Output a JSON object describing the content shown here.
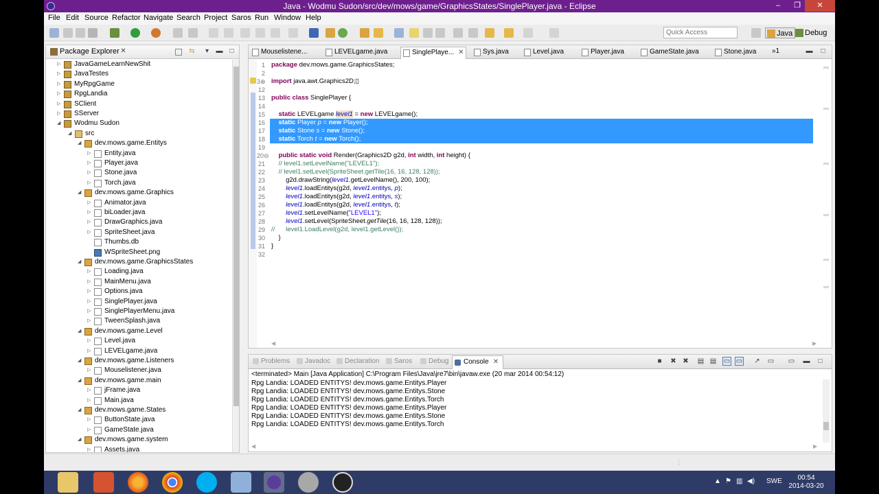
{
  "window": {
    "title": "Java - Wodmu Sudon/src/dev/mows/game/GraphicsStates/SinglePlayer.java - Eclipse",
    "minimize": "–",
    "maximize": "❐",
    "close": "✕"
  },
  "menu": [
    "File",
    "Edit",
    "Source",
    "Refactor",
    "Navigate",
    "Search",
    "Project",
    "Saros",
    "Run",
    "Window",
    "Help"
  ],
  "toolbar": {
    "quick_access_placeholder": "Quick Access",
    "perspectives": [
      "Java",
      "Debug"
    ]
  },
  "package_explorer": {
    "title": "Package Explorer",
    "tree": [
      {
        "label": "JavaGameLearnNewShit",
        "depth": 0,
        "kind": "proj",
        "expanded": false
      },
      {
        "label": "JavaTestes",
        "depth": 0,
        "kind": "proj",
        "expanded": false
      },
      {
        "label": "MyRpgGame",
        "depth": 0,
        "kind": "proj",
        "expanded": false
      },
      {
        "label": "RpgLandia",
        "depth": 0,
        "kind": "proj",
        "expanded": false
      },
      {
        "label": "SClient",
        "depth": 0,
        "kind": "proj",
        "expanded": false
      },
      {
        "label": "SServer",
        "depth": 0,
        "kind": "proj",
        "expanded": false
      },
      {
        "label": "Wodmu Sudon",
        "depth": 0,
        "kind": "proj",
        "expanded": true
      },
      {
        "label": "src",
        "depth": 1,
        "kind": "src",
        "expanded": true
      },
      {
        "label": "dev.mows.game.Entitys",
        "depth": 2,
        "kind": "pkgi",
        "expanded": true
      },
      {
        "label": "Entity.java",
        "depth": 3,
        "kind": "file",
        "expanded": false
      },
      {
        "label": "Player.java",
        "depth": 3,
        "kind": "file",
        "expanded": false
      },
      {
        "label": "Stone.java",
        "depth": 3,
        "kind": "file",
        "expanded": false
      },
      {
        "label": "Torch.java",
        "depth": 3,
        "kind": "file",
        "expanded": false
      },
      {
        "label": "dev.mows.game.Graphics",
        "depth": 2,
        "kind": "pkgi",
        "expanded": true
      },
      {
        "label": "Animator.java",
        "depth": 3,
        "kind": "file",
        "expanded": false
      },
      {
        "label": "biLoader.java",
        "depth": 3,
        "kind": "file",
        "expanded": false
      },
      {
        "label": "DrawGraphics.java",
        "depth": 3,
        "kind": "file",
        "expanded": false
      },
      {
        "label": "SpriteSheet.java",
        "depth": 3,
        "kind": "file",
        "expanded": false
      },
      {
        "label": "Thumbs.db",
        "depth": 3,
        "kind": "file",
        "expanded": null
      },
      {
        "label": "WSpriteSheet.png",
        "depth": 3,
        "kind": "img",
        "expanded": null
      },
      {
        "label": "dev.mows.game.GraphicsStates",
        "depth": 2,
        "kind": "pkgi",
        "expanded": true
      },
      {
        "label": "Loading.java",
        "depth": 3,
        "kind": "file",
        "expanded": false
      },
      {
        "label": "MainMenu.java",
        "depth": 3,
        "kind": "file",
        "expanded": false
      },
      {
        "label": "Options.java",
        "depth": 3,
        "kind": "file",
        "expanded": false
      },
      {
        "label": "SinglePlayer.java",
        "depth": 3,
        "kind": "file",
        "expanded": false
      },
      {
        "label": "SinglePlayerMenu.java",
        "depth": 3,
        "kind": "file",
        "expanded": false
      },
      {
        "label": "TweenSplash.java",
        "depth": 3,
        "kind": "file",
        "expanded": false
      },
      {
        "label": "dev.mows.game.Level",
        "depth": 2,
        "kind": "pkgi",
        "expanded": true
      },
      {
        "label": "Level.java",
        "depth": 3,
        "kind": "file",
        "expanded": false
      },
      {
        "label": "LEVELgame.java",
        "depth": 3,
        "kind": "file",
        "expanded": false
      },
      {
        "label": "dev.mows.game.Listeners",
        "depth": 2,
        "kind": "pkgi",
        "expanded": true
      },
      {
        "label": "Mouselistener.java",
        "depth": 3,
        "kind": "file",
        "expanded": false
      },
      {
        "label": "dev.mows.game.main",
        "depth": 2,
        "kind": "pkgi",
        "expanded": true
      },
      {
        "label": "jFrame.java",
        "depth": 3,
        "kind": "file",
        "expanded": false
      },
      {
        "label": "Main.java",
        "depth": 3,
        "kind": "file",
        "expanded": false
      },
      {
        "label": "dev.mows.game.States",
        "depth": 2,
        "kind": "pkgi",
        "expanded": true
      },
      {
        "label": "ButtonState.java",
        "depth": 3,
        "kind": "file",
        "expanded": false
      },
      {
        "label": "GameState.java",
        "depth": 3,
        "kind": "file",
        "expanded": false
      },
      {
        "label": "dev.mows.game.system",
        "depth": 2,
        "kind": "pkgi",
        "expanded": true
      },
      {
        "label": "Assets.java",
        "depth": 3,
        "kind": "file",
        "expanded": false
      }
    ]
  },
  "editor": {
    "tabs": [
      {
        "label": "Mouselistene...",
        "active": false
      },
      {
        "label": "LEVELgame.java",
        "active": false
      },
      {
        "label": "SinglePlaye...",
        "active": true
      },
      {
        "label": "Sys.java",
        "active": false
      },
      {
        "label": "Level.java",
        "active": false
      },
      {
        "label": "Player.java",
        "active": false
      },
      {
        "label": "GameState.java",
        "active": false
      },
      {
        "label": "Stone.java",
        "active": false
      }
    ],
    "overflow": "»1",
    "lines": [
      {
        "n": "1",
        "selected": false,
        "html": "<span class=\"kw\">package</span> dev.mows.game.GraphicsStates;"
      },
      {
        "n": "2",
        "selected": false,
        "html": ""
      },
      {
        "n": "3⊕",
        "selected": false,
        "html": "<span class=\"kw\">import</span> java.awt.Graphics2D;▯"
      },
      {
        "n": "12",
        "selected": false,
        "html": ""
      },
      {
        "n": "13",
        "selected": false,
        "html": "<span class=\"kw\">public class</span> SinglePlayer {"
      },
      {
        "n": "14",
        "selected": false,
        "html": ""
      },
      {
        "n": "15",
        "selected": false,
        "html": "    <span class=\"kw\">static</span> LEVELgame <span class=\"fld\" style=\"background:#f0e0c8\">level1</span> = <span class=\"kw\">new</span> LEVELgame();"
      },
      {
        "n": "16",
        "selected": true,
        "html": "    <span>static</span> Player <span>p</span> = <span>new</span> Player();"
      },
      {
        "n": "17",
        "selected": true,
        "html": "    <span>static</span> Stone <span>s</span> = <span>new</span> Stone();"
      },
      {
        "n": "18",
        "selected": true,
        "html": "    <span>static</span> Torch <span>t</span> = <span>new</span> Torch();"
      },
      {
        "n": "19",
        "selected": false,
        "html": ""
      },
      {
        "n": "20⊖",
        "selected": false,
        "html": "    <span class=\"kw\">public static void</span> Render(Graphics2D g2d, <span class=\"kw\">int</span> width, <span class=\"kw\">int</span> height) {"
      },
      {
        "n": "21",
        "selected": false,
        "html": "    <span class=\"cm\">// level1.setLevelName(\"LEVEL1\");</span>"
      },
      {
        "n": "22",
        "selected": false,
        "html": "    <span class=\"cm\">// level1.setLevel(SpriteSheet.getTile(16, 16, 128, 128));</span>"
      },
      {
        "n": "23",
        "selected": false,
        "html": "        g2d.drawString(<span class=\"fld\">level1</span>.getLevelName(), 200, 100);"
      },
      {
        "n": "24",
        "selected": false,
        "html": "        <span class=\"fld\">level1</span>.loadEntitys(g2d, <span class=\"fld\">level1</span>.<span class=\"fld\" style=\"font-style:normal\">entitys</span>, <span class=\"fld\">p</span>);"
      },
      {
        "n": "25",
        "selected": false,
        "html": "        <span class=\"fld\">level1</span>.loadEntitys(g2d, <span class=\"fld\">level1</span>.<span class=\"fld\" style=\"font-style:normal\">entitys</span>, <span class=\"fld\">s</span>);"
      },
      {
        "n": "26",
        "selected": false,
        "html": "        <span class=\"fld\">level1</span>.loadEntitys(g2d, <span class=\"fld\">level1</span>.<span class=\"fld\" style=\"font-style:normal\">entitys</span>, <span class=\"fld\">t</span>);"
      },
      {
        "n": "27",
        "selected": false,
        "html": "        <span class=\"fld\">level1</span>.setLevelName(<span class=\"st\">\"LEVEL1\"</span>);"
      },
      {
        "n": "28",
        "selected": false,
        "html": "        <span class=\"fld\">level1</span>.setLevel(SpriteSheet.<i>getTile</i>(16, 16, 128, 128));"
      },
      {
        "n": "29",
        "selected": false,
        "html": "<span class=\"cm\">//      level1.LoadLevel(g2d, level1.getLevel());</span>"
      },
      {
        "n": "30",
        "selected": false,
        "html": "    }"
      },
      {
        "n": "31",
        "selected": false,
        "html": "}"
      },
      {
        "n": "32",
        "selected": false,
        "html": ""
      }
    ]
  },
  "console": {
    "tabs": [
      {
        "label": "Problems",
        "active": false
      },
      {
        "label": "Javadoc",
        "active": false
      },
      {
        "label": "Declaration",
        "active": false
      },
      {
        "label": "Saros",
        "active": false
      },
      {
        "label": "Debug",
        "active": false
      },
      {
        "label": "Console",
        "active": true
      }
    ],
    "terminated": "<terminated> Main [Java Application] C:\\Program Files\\Java\\jre7\\bin\\javaw.exe (20 mar 2014 00:54:12)",
    "output": [
      "Rpg Landia: LOADED ENTITYS! dev.mows.game.Entitys.Player",
      "Rpg Landia: LOADED ENTITYS! dev.mows.game.Entitys.Stone",
      "Rpg Landia: LOADED ENTITYS! dev.mows.game.Entitys.Torch",
      "Rpg Landia: LOADED ENTITYS! dev.mows.game.Entitys.Player",
      "Rpg Landia: LOADED ENTITYS! dev.mows.game.Entitys.Stone",
      "Rpg Landia: LOADED ENTITYS! dev.mows.game.Entitys.Torch"
    ]
  },
  "taskbar": {
    "language": "SWE",
    "time": "00:54",
    "date": "2014-03-20"
  }
}
